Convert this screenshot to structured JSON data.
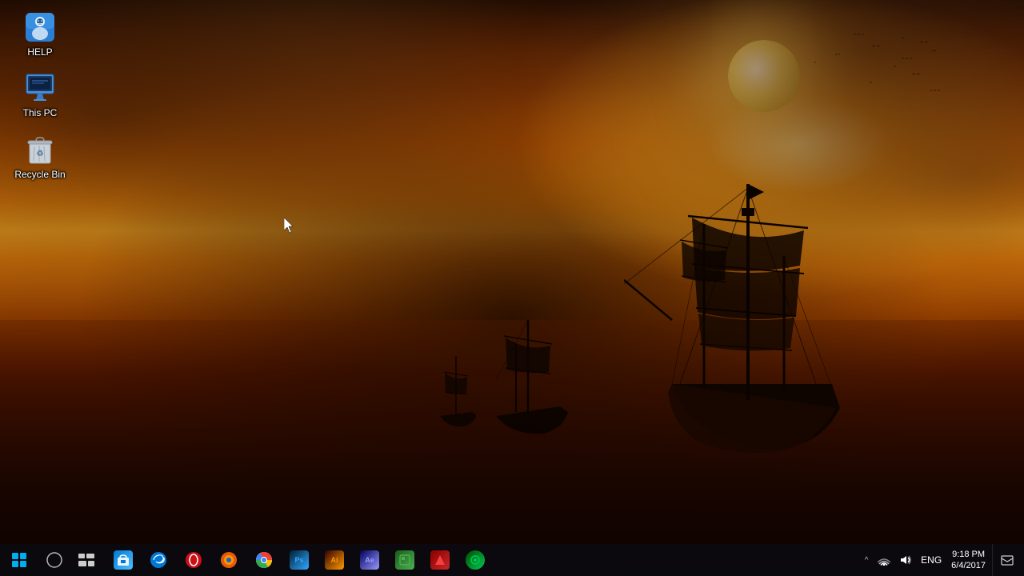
{
  "desktop": {
    "icons": [
      {
        "id": "help",
        "label": "HELP",
        "icon_type": "help"
      },
      {
        "id": "this-pc",
        "label": "This PC",
        "icon_type": "thispc"
      },
      {
        "id": "recycle-bin",
        "label": "Recycle Bin",
        "icon_type": "recycle"
      }
    ]
  },
  "taskbar": {
    "start_label": "Start",
    "search_label": "Search",
    "taskview_label": "Task View",
    "apps": [
      {
        "id": "store",
        "label": "Microsoft Store",
        "icon_class": "store-icon",
        "symbol": "🛍"
      },
      {
        "id": "edge",
        "label": "Microsoft Edge",
        "icon_class": "edge-icon",
        "symbol": "e"
      },
      {
        "id": "opera",
        "label": "Opera",
        "icon_class": "opera-icon",
        "symbol": "O"
      },
      {
        "id": "firefox",
        "label": "Firefox",
        "icon_class": "firefox-icon",
        "symbol": "🦊"
      },
      {
        "id": "chrome",
        "label": "Google Chrome",
        "icon_class": "chrome-icon",
        "symbol": "⬤"
      },
      {
        "id": "photoshop",
        "label": "Adobe Photoshop",
        "icon_class": "ps-icon",
        "symbol": "Ps"
      },
      {
        "id": "illustrator",
        "label": "Adobe Illustrator",
        "icon_class": "ai-icon",
        "symbol": "Ai"
      },
      {
        "id": "aftereffects",
        "label": "Adobe After Effects",
        "icon_class": "ae-icon",
        "symbol": "Ae"
      },
      {
        "id": "green-app",
        "label": "App",
        "icon_class": "green-app",
        "symbol": "▣"
      },
      {
        "id": "red-app",
        "label": "App2",
        "icon_class": "red-app",
        "symbol": "◆"
      },
      {
        "id": "green-app2",
        "label": "App3",
        "icon_class": "green-app2",
        "symbol": "◉"
      }
    ],
    "tray": {
      "expand_label": "^",
      "network_label": "Network",
      "volume_label": "Volume",
      "lang_label": "ENG"
    },
    "clock": {
      "time": "9:18 PM",
      "date": "6/4/2017"
    },
    "notification_label": "Notifications"
  }
}
